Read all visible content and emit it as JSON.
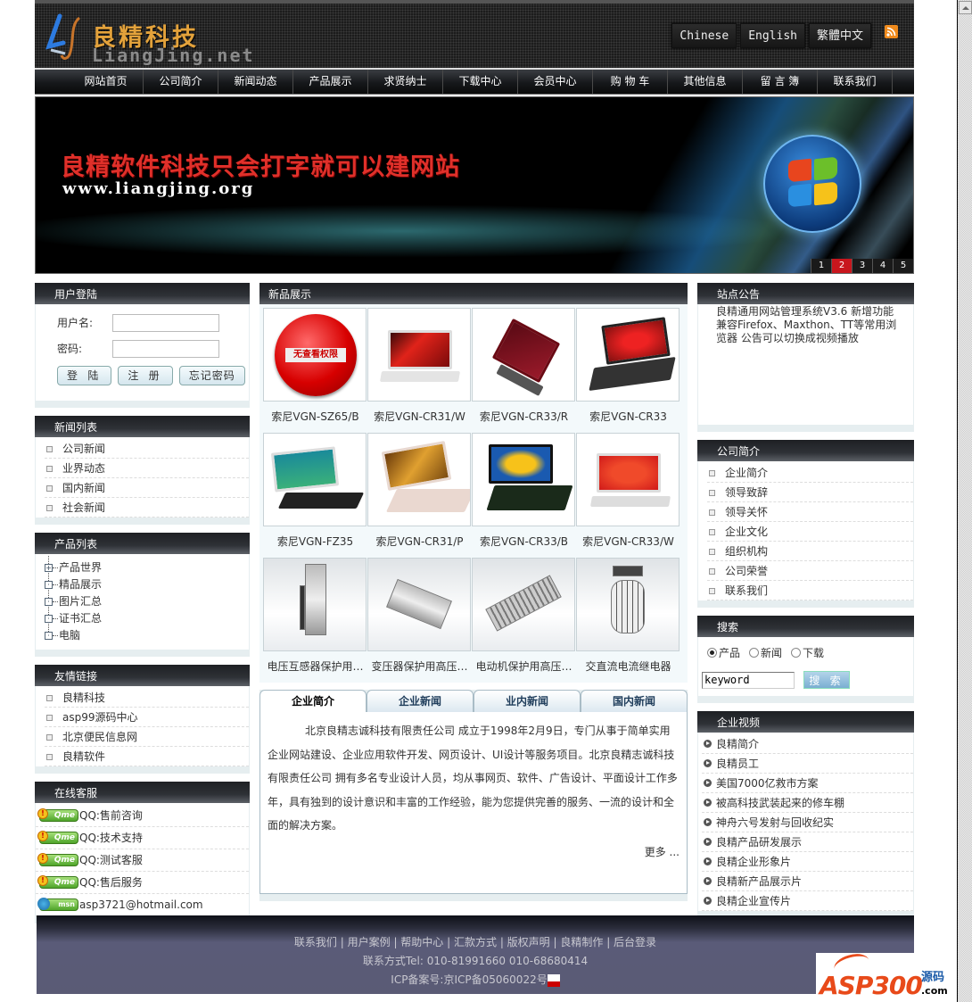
{
  "header": {
    "logo_cn": "良精科技",
    "logo_en": "LiangJing.net",
    "languages": [
      "Chinese",
      "English",
      "繁體中文"
    ],
    "rss_icon": "rss-icon"
  },
  "nav": [
    "网站首页",
    "公司简介",
    "新闻动态",
    "产品展示",
    "求贤纳士",
    "下载中心",
    "会员中心",
    "购 物 车",
    "其他信息",
    "留 言 簿",
    "联系我们"
  ],
  "banner": {
    "slogan": "良精软件科技只会打字就可以建网站",
    "url": "www.liangjing.org",
    "pages": [
      "1",
      "2",
      "3",
      "4",
      "5"
    ],
    "active_page": "2"
  },
  "login": {
    "title": "用户登陆",
    "username_label": "用户名:",
    "username_value": "",
    "password_label": "密码:",
    "password_value": "",
    "buttons": [
      "登 陆",
      "注 册",
      "忘记密码"
    ]
  },
  "news_list": {
    "title": "新闻列表",
    "items": [
      "公司新闻",
      "业界动态",
      "国内新闻",
      "社会新闻"
    ]
  },
  "product_list": {
    "title": "产品列表",
    "items": [
      {
        "label": "产品世界",
        "expandable": true
      },
      {
        "label": "精品展示",
        "expandable": false
      },
      {
        "label": "图片汇总",
        "expandable": false
      },
      {
        "label": "证书汇总",
        "expandable": false
      },
      {
        "label": "电脑",
        "expandable": false
      }
    ]
  },
  "friend_links": {
    "title": "友情链接",
    "items": [
      "良精科技",
      "asp99源码中心",
      "北京便民信息网",
      "良精软件"
    ]
  },
  "online_service": {
    "title": "在线客服",
    "items": [
      {
        "type": "qq",
        "badge": "Qme",
        "label": "QQ:售前咨询"
      },
      {
        "type": "qq",
        "badge": "Qme",
        "label": "QQ:技术支持"
      },
      {
        "type": "qq",
        "badge": "Qme",
        "label": "QQ:测试客服"
      },
      {
        "type": "qq",
        "badge": "Qme",
        "label": "QQ:售后服务"
      },
      {
        "type": "msn",
        "badge": "msn",
        "label": "asp3721@hotmail.com"
      }
    ]
  },
  "new_products": {
    "title": "新品展示",
    "items": [
      {
        "name": "索尼VGN-SZ65/B",
        "image": "no-permission",
        "overlay_text": "无查看权限"
      },
      {
        "name": "索尼VGN-CR31/W",
        "image": "laptop-white-red-leaves"
      },
      {
        "name": "索尼VGN-CR33/R",
        "image": "laptop-red"
      },
      {
        "name": "索尼VGN-CR33",
        "image": "laptop-black-strawberries"
      },
      {
        "name": "索尼VGN-FZ35",
        "image": "laptop-white-cartoon"
      },
      {
        "name": "索尼VGN-CR31/P",
        "image": "laptop-pink"
      },
      {
        "name": "索尼VGN-CR33/B",
        "image": "laptop-black-sunflower"
      },
      {
        "name": "索尼VGN-CR33/W",
        "image": "laptop-white-flower"
      },
      {
        "name": "电压互感器保护用…",
        "image": "industrial-device-1"
      },
      {
        "name": "变压器保护用高压…",
        "image": "industrial-device-2"
      },
      {
        "name": "电动机保护用高压…",
        "image": "industrial-device-3"
      },
      {
        "name": "交直流电流继电器",
        "image": "industrial-lamp"
      }
    ]
  },
  "tabs": {
    "items": [
      "企业简介",
      "企业新闻",
      "业内新闻",
      "国内新闻"
    ],
    "active": "企业简介",
    "content": "北京良精志诚科技有限责任公司 成立于1998年2月9日，专门从事于简单实用企业网站建设、企业应用软件开发、网页设计、UI设计等服务项目。北京良精志诚科技有限责任公司 拥有多名专业设计人员，均从事网页、软件、广告设计、平面设计工作多年，具有独到的设计意识和丰富的工作经验，能为您提供完善的服务、一流的设计和全面的解决方案。",
    "more": "更多 ..."
  },
  "notice": {
    "title": "站点公告",
    "text": "良精通用网站管理系统V3.6 新增功能 兼容Firefox、Maxthon、TT等常用浏览器 公告可以切换成视频播放"
  },
  "company": {
    "title": "公司简介",
    "items": [
      "企业简介",
      "领导致辞",
      "领导关怀",
      "企业文化",
      "组织机构",
      "公司荣誉",
      "联系我们"
    ]
  },
  "search": {
    "title": "搜索",
    "options": [
      "产品",
      "新闻",
      "下载"
    ],
    "selected": "产品",
    "keyword_value": "keyword",
    "button": "搜 索"
  },
  "videos": {
    "title": "企业视频",
    "items": [
      "良精简介",
      "良精员工",
      "美国7000亿救市方案",
      "被高科技武装起来的修车棚",
      "神舟六号发射与回收纪实",
      "良精产品研发展示",
      "良精企业形象片",
      "良精新产品展示片",
      "良精企业宣传片"
    ]
  },
  "footer": {
    "links": [
      "联系我们",
      "用户案例",
      "帮助中心",
      "汇款方式",
      "版权声明",
      "良精制作",
      "后台登录"
    ],
    "contact": "联系方式Tel: 010-81991660 010-68680414",
    "icp": "ICP备案号:京ICP备05060022号"
  },
  "watermark": {
    "brand": "ASP300",
    "sub": "源码",
    "domain": ".com"
  }
}
